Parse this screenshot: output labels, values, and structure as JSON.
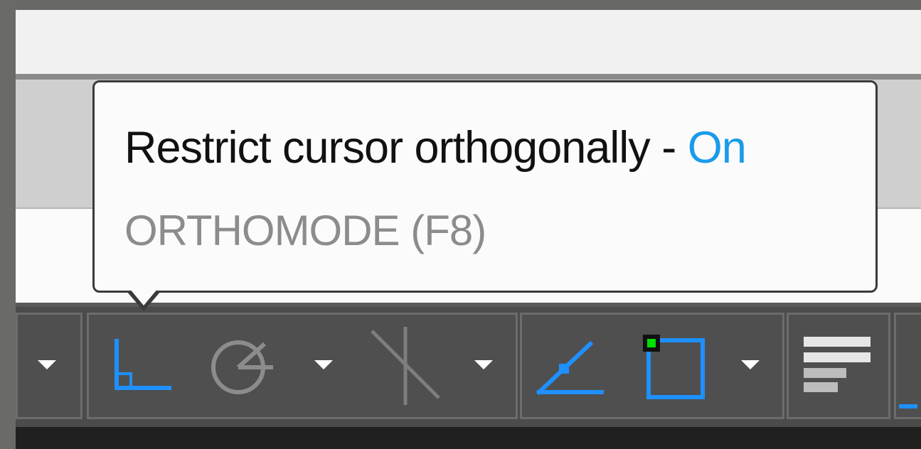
{
  "tooltip": {
    "title_prefix": "Restrict cursor orthogonally - ",
    "title_state": "On",
    "command": "ORTHOMODE (F8)"
  },
  "statusbar": {
    "icons": [
      {
        "name": "ortho-mode-icon",
        "active": true
      },
      {
        "name": "polar-tracking-icon",
        "active": false
      },
      {
        "name": "isometric-drafting-icon",
        "active": false
      },
      {
        "name": "object-snap-tracking-icon",
        "active": true
      },
      {
        "name": "object-snap-icon",
        "active": true
      },
      {
        "name": "lineweight-icon",
        "active": false
      }
    ]
  },
  "colors": {
    "accent": "#1e90ff",
    "on_text": "#1a9bea",
    "snap_marker": "#00e000"
  }
}
